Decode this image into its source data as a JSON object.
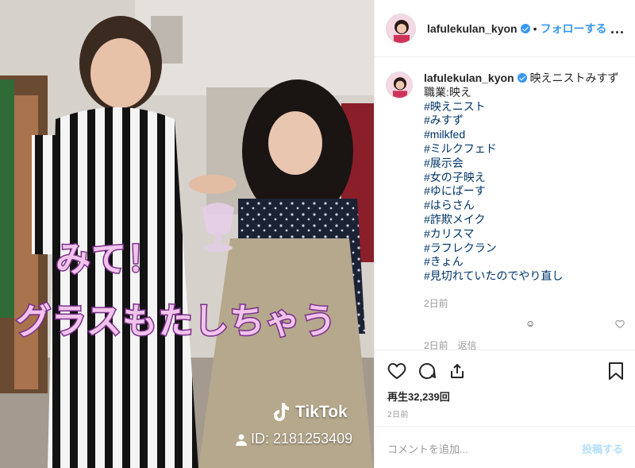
{
  "media": {
    "caption_line1": "みて！",
    "caption_line2": "グラスもたしちゃう",
    "tiktok_name": "TikTok",
    "tiktok_id": "ID: 2181253409"
  },
  "header": {
    "username": "lafulekulan_kyon",
    "separator": "•",
    "follow_label": "フォローする",
    "more_label": "..."
  },
  "post": {
    "username": "lafulekulan_kyon",
    "caption_first": "映えニストみすず",
    "caption_line2": "職業:映え",
    "hashtags": [
      "#映えニスト",
      "#みすず",
      "#milkfed",
      "#ミルクフェド",
      "#展示会",
      "#女の子映え",
      "#ゆにばーす",
      "#はらさん",
      "#詐欺メイク",
      "#カリスマ",
      "#ラフレクラン",
      "#きょん",
      "#見切れていたのでやり直し"
    ],
    "time": "2日前",
    "reply_emoji": "☺",
    "partial_comment": "2日前　返信"
  },
  "actions": {
    "views": "再生32,239回",
    "date": "2日前"
  },
  "comment_box": {
    "placeholder": "コメントを追加...",
    "post_label": "投稿する"
  },
  "colors": {
    "accent": "#3897f0",
    "caption_fill": "#f2c4ec",
    "caption_stroke": "#7a2f8a",
    "hashtag": "#003569"
  }
}
